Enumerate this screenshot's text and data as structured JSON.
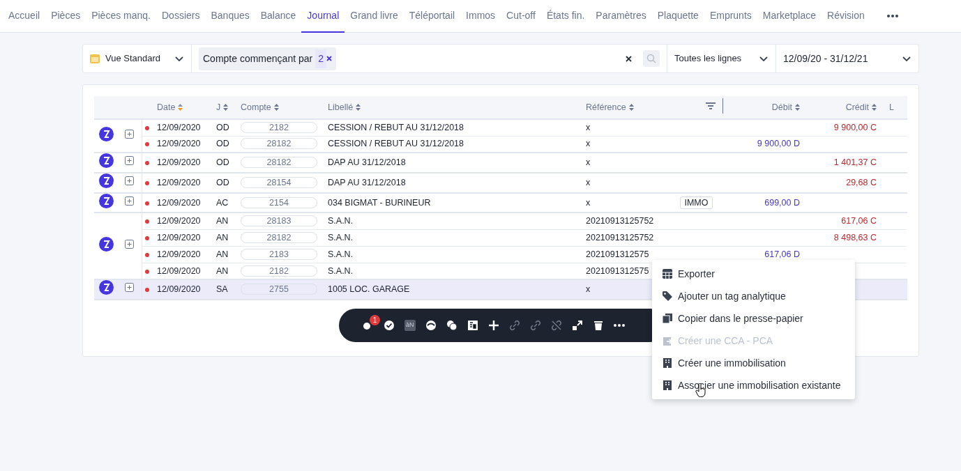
{
  "nav": [
    {
      "label": "Accueil",
      "selected": false
    },
    {
      "label": "Pièces",
      "selected": false
    },
    {
      "label": "Pièces manq.",
      "selected": false
    },
    {
      "label": "Dossiers",
      "selected": false
    },
    {
      "label": "Banques",
      "selected": false
    },
    {
      "label": "Balance",
      "selected": false
    },
    {
      "label": "Journal",
      "selected": true
    },
    {
      "label": "Grand livre",
      "selected": false
    },
    {
      "label": "Téléportail",
      "selected": false
    },
    {
      "label": "Immos",
      "selected": false
    },
    {
      "label": "Cut-off",
      "selected": false
    },
    {
      "label": "États fin.",
      "selected": false
    },
    {
      "label": "Paramètres",
      "selected": false
    },
    {
      "label": "Plaquette",
      "selected": false
    },
    {
      "label": "Emprunts",
      "selected": false
    },
    {
      "label": "Marketplace",
      "selected": false
    },
    {
      "label": "Révision",
      "selected": false
    }
  ],
  "filter_bar": {
    "view": "Vue Standard",
    "chip": {
      "label": "Compte commençant par",
      "value": "2"
    },
    "lines": "Toutes les lignes",
    "period": "12/09/20 - 31/12/21"
  },
  "table": {
    "columns": [
      {
        "label": "Date",
        "sorted": true
      },
      {
        "label": "J",
        "sorted": false
      },
      {
        "label": "Compte",
        "sorted": false
      },
      {
        "label": "Libellé",
        "sorted": false
      },
      {
        "label": "Référence",
        "sorted": false
      },
      {
        "label": "Débit",
        "sorted": false
      },
      {
        "label": "Crédit",
        "sorted": false
      },
      {
        "label": "L"
      }
    ],
    "entries": [
      {
        "selected": false,
        "lines": [
          {
            "date": "12/09/2020",
            "journal": "OD",
            "account": "2182",
            "label": "CESSION / REBUT AU 31/12/2018",
            "reference": "x",
            "credit": "9 900,00 C"
          },
          {
            "date": "12/09/2020",
            "journal": "OD",
            "account": "28182",
            "label": "CESSION / REBUT AU 31/12/2018",
            "reference": "x",
            "debit": "9 900,00 D"
          }
        ]
      },
      {
        "selected": false,
        "lines": [
          {
            "date": "12/09/2020",
            "journal": "OD",
            "account": "28182",
            "label": "DAP AU 31/12/2018",
            "reference": "x",
            "credit": "1 401,37 C"
          }
        ]
      },
      {
        "selected": false,
        "lines": [
          {
            "date": "12/09/2020",
            "journal": "OD",
            "account": "28154",
            "label": "DAP AU 31/12/2018",
            "reference": "x",
            "credit": "29,68 C"
          }
        ]
      },
      {
        "selected": false,
        "lines": [
          {
            "date": "12/09/2020",
            "journal": "AC",
            "account": "2154",
            "label": "034 BIGMAT - BURINEUR",
            "reference": "x",
            "tag": "IMMO",
            "debit": "699,00 D"
          }
        ]
      },
      {
        "selected": false,
        "lines": [
          {
            "date": "12/09/2020",
            "journal": "AN",
            "account": "28183",
            "label": "S.A.N.",
            "reference": "20210913125752",
            "credit": "617,06 C"
          },
          {
            "date": "12/09/2020",
            "journal": "AN",
            "account": "28182",
            "label": "S.A.N.",
            "reference": "20210913125752",
            "credit": "8 498,63 C"
          },
          {
            "date": "12/09/2020",
            "journal": "AN",
            "account": "2183",
            "label": "S.A.N.",
            "reference": "2021091312575",
            "debit": "617,06 D"
          },
          {
            "date": "12/09/2020",
            "journal": "AN",
            "account": "2182",
            "label": "S.A.N.",
            "reference": "2021091312575"
          }
        ]
      },
      {
        "selected": true,
        "lines": [
          {
            "date": "12/09/2020",
            "journal": "SA",
            "account": "2755",
            "label": "1005 LOC. GARAGE",
            "reference": "x"
          }
        ]
      }
    ]
  },
  "toolbar": {
    "badge": "1",
    "tool_text": "àN"
  },
  "context_menu": [
    {
      "label": "Exporter",
      "disabled": false
    },
    {
      "label": "Ajouter un tag analytique",
      "disabled": false
    },
    {
      "label": "Copier dans le presse-papier",
      "disabled": false
    },
    {
      "label": "Créer une CCA - PCA",
      "disabled": true
    },
    {
      "label": "Créer une immobilisation",
      "disabled": false
    },
    {
      "label": "Associer une immobilisation existante",
      "disabled": false
    }
  ]
}
